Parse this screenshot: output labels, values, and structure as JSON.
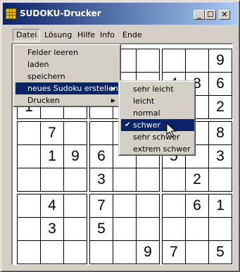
{
  "window": {
    "title": "SUDOKU-Drucker",
    "minimize": "_",
    "maximize": "☐",
    "close": "✕"
  },
  "menubar": [
    "Datei",
    "Lösung",
    "Hilfe",
    "Info",
    "Ende"
  ],
  "datei_menu": [
    {
      "label": "Felder leeren",
      "submenu": false
    },
    {
      "label": "laden",
      "submenu": false
    },
    {
      "label": "speichern",
      "submenu": false
    },
    {
      "label": "neues Sudoku erstellen",
      "submenu": true,
      "arrow": "▶",
      "highlighted": true
    },
    {
      "label": "Drucken",
      "submenu": true,
      "arrow": "▶",
      "highlighted": false
    }
  ],
  "difficulty_menu": [
    {
      "label": "sehr leicht",
      "checked": false
    },
    {
      "label": "leicht",
      "checked": false
    },
    {
      "label": "normal",
      "checked": false
    },
    {
      "label": "schwer",
      "checked": true,
      "check": "✔"
    },
    {
      "label": "sehr schwer",
      "checked": false
    },
    {
      "label": "extrem schwer",
      "checked": false
    }
  ],
  "grid": [
    [
      "",
      "",
      "",
      "",
      "",
      "",
      "",
      "",
      "9"
    ],
    [
      "",
      "",
      "",
      "",
      "",
      "",
      "4",
      "8",
      "6"
    ],
    [
      "1",
      "",
      "",
      "",
      "",
      "",
      "",
      "",
      "2"
    ],
    [
      "",
      "7",
      "",
      "",
      "",
      "",
      "",
      "",
      "8"
    ],
    [
      "",
      "1",
      "9",
      "6",
      "",
      "",
      "5",
      "",
      "3"
    ],
    [
      "",
      "",
      "",
      "3",
      "",
      "",
      "",
      "2",
      ""
    ],
    [
      "",
      "4",
      "",
      "7",
      "",
      "",
      "",
      "6",
      "1"
    ],
    [
      "",
      "3",
      "",
      "5",
      "",
      "",
      "",
      "",
      ""
    ],
    [
      "",
      "",
      "",
      "",
      "",
      "9",
      "7",
      "",
      "5"
    ]
  ]
}
